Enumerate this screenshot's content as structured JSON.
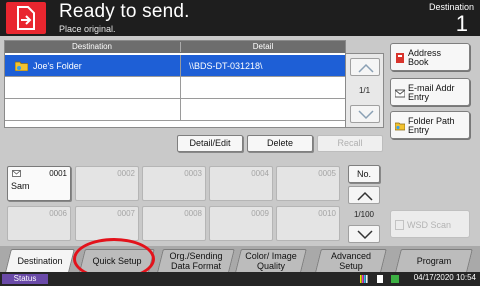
{
  "header": {
    "title": "Ready to send.",
    "subtitle": "Place original.",
    "destination_label": "Destination",
    "destination_count": "1"
  },
  "list": {
    "columns": [
      "Destination",
      "Detail"
    ],
    "rows": [
      {
        "name": "Joe's Folder",
        "detail": "\\\\BDS-DT-031218\\",
        "selected": true
      },
      {
        "name": "",
        "detail": "",
        "selected": false
      },
      {
        "name": "",
        "detail": "",
        "selected": false
      }
    ],
    "page": "1/1"
  },
  "right_buttons": {
    "address_book": "Address Book",
    "email_entry": "E-mail Addr Entry",
    "folder_path_entry": "Folder Path Entry"
  },
  "actions": {
    "detail_edit": "Detail/Edit",
    "delete": "Delete",
    "recall": "Recall"
  },
  "one_touch": {
    "keys": [
      {
        "num": "0001",
        "name": "Sam"
      },
      {
        "num": "0002",
        "name": ""
      },
      {
        "num": "0003",
        "name": ""
      },
      {
        "num": "0004",
        "name": ""
      },
      {
        "num": "0005",
        "name": ""
      },
      {
        "num": "0006",
        "name": ""
      },
      {
        "num": "0007",
        "name": ""
      },
      {
        "num": "0008",
        "name": ""
      },
      {
        "num": "0009",
        "name": ""
      },
      {
        "num": "0010",
        "name": ""
      }
    ],
    "no_label": "No.",
    "page": "1/100",
    "wsd_scan": "WSD Scan"
  },
  "tabs": [
    {
      "label": "Destination",
      "active": true
    },
    {
      "label": "Quick Setup",
      "active": false
    },
    {
      "label": "Org./Sending Data Format",
      "active": false
    },
    {
      "label": "Color/ Image Quality",
      "active": false
    },
    {
      "label": "Advanced Setup",
      "active": false
    },
    {
      "label": "Program",
      "active": false
    }
  ],
  "status": {
    "button": "Status",
    "datetime": "04/17/2020  10:54"
  },
  "colors": {
    "accent_red": "#e9262f",
    "selection_blue": "#1e5fd6",
    "status_purple": "#6a4aa8"
  }
}
